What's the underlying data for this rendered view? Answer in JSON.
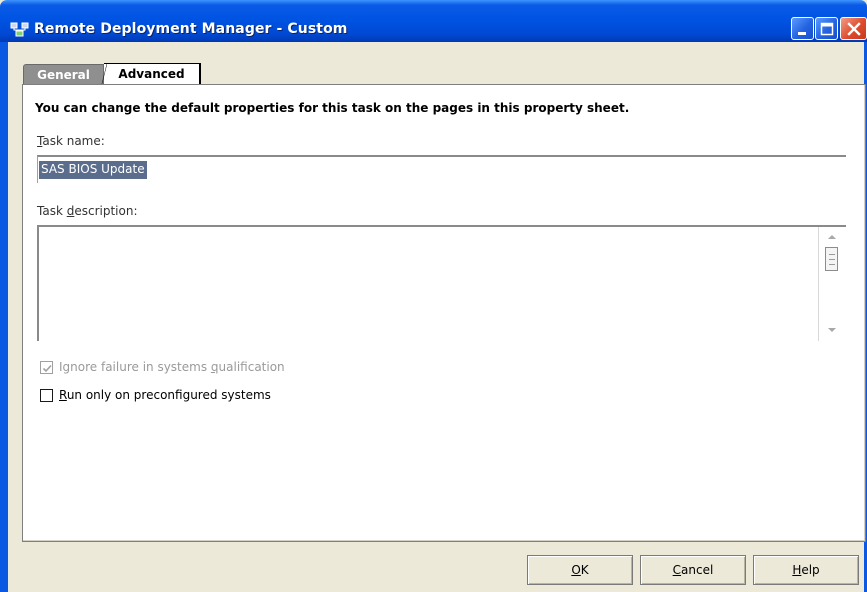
{
  "window": {
    "title": "Remote Deployment Manager - Custom",
    "colors": {
      "titlebar": "#0054e3",
      "frame": "#0b58e3",
      "close_button": "#de4b2c",
      "selection": "#5a6d8c",
      "face": "#ece9d8"
    }
  },
  "tabs": [
    {
      "label": "General",
      "selected": false
    },
    {
      "label": "Advanced",
      "selected": true
    }
  ],
  "intro_text": "You can change the default properties for this task on the pages in this property sheet.",
  "task_name": {
    "label_mnemonic": "T",
    "label_rest": "ask name:",
    "value": "SAS BIOS Update"
  },
  "task_description": {
    "label_pre": "Task ",
    "label_mnemonic": "d",
    "label_post": "escription:",
    "value": ""
  },
  "checkboxes": [
    {
      "label_pre": "Ignore failure in systems ",
      "label_mnemonic": "q",
      "label_post": "ualification",
      "checked": true,
      "enabled": false
    },
    {
      "label_pre": "",
      "label_mnemonic": "R",
      "label_post": "un only on preconfigured systems",
      "checked": false,
      "enabled": true
    }
  ],
  "buttons": {
    "ok": {
      "mnemonic": "O",
      "rest": "K"
    },
    "cancel": {
      "mnemonic": "C",
      "rest": "ancel"
    },
    "help": {
      "mnemonic": "H",
      "rest": "elp"
    }
  },
  "icons": {
    "app": "network-deploy-icon",
    "minimize": "minimize-icon",
    "maximize": "maximize-icon",
    "close": "close-icon",
    "scroll_up": "arrow-up-icon",
    "scroll_down": "arrow-down-icon",
    "check": "checkmark-icon"
  }
}
